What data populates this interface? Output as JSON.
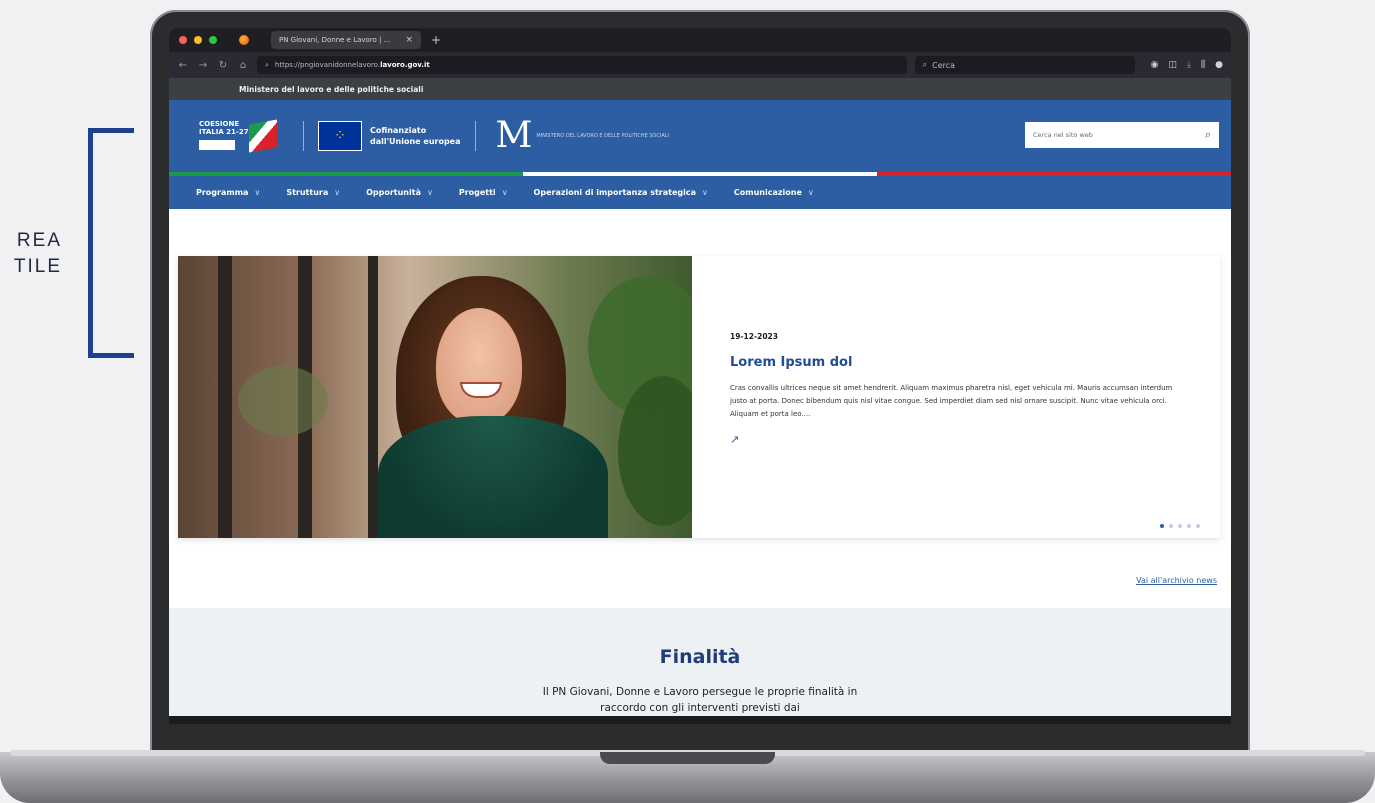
{
  "annotation": {
    "line1": "REA",
    "line2": "TILE"
  },
  "browser": {
    "tab_title": "PN Giovani, Donne e Lavoro | ...",
    "tab_close": "×",
    "new_tab": "+",
    "url_prefix": "https://pngiovanidonnelavoro.",
    "url_domain": "lavoro.gov.it",
    "search_placeholder": "Cerca"
  },
  "ministry": {
    "label": "Ministero del lavoro e delle politiche sociali"
  },
  "header": {
    "coesione_line1": "COESIONE",
    "coesione_line2": "ITALIA 21-27",
    "eu_line1": "Cofinanziato",
    "eu_line2": "dall'Unione europea",
    "m_letter": "M",
    "m_sub": "MINISTERO DEL LAVORO E DELLE POLITICHE SOCIALI",
    "site_search_placeholder": "Cerca nel sito web"
  },
  "nav": {
    "items": [
      {
        "label": "Programma"
      },
      {
        "label": "Struttura"
      },
      {
        "label": "Opportunità"
      },
      {
        "label": "Progetti"
      },
      {
        "label": "Operazioni di importanza strategica"
      },
      {
        "label": "Comunicazione"
      }
    ]
  },
  "hero": {
    "date": "19-12-2023",
    "title": "Lorem Ipsum dol",
    "body": "Cras convallis ultrices neque sit amet hendrerit. Aliquam maximus pharetra nisl, eget vehicula mi. Mauris accumsan interdum justo at porta. Donec bibendum quis nisl vitae congue. Sed imperdiet diam sed nisl ornare suscipit. Nunc vitae vehicula orci. Aliquam et porta leo....",
    "slides_total": 5,
    "slides_active": 1
  },
  "archive_link": "Vai all'archivio news",
  "finalita": {
    "title": "Finalità",
    "body": "Il PN Giovani, Donne e Lavoro persegue le proprie finalità in raccordo con gli interventi previsti dai"
  },
  "colors": {
    "brand_blue": "#2d5ea3",
    "tricolor_green": "#1a9b4b",
    "tricolor_white": "#ffffff",
    "tricolor_red": "#d8232a"
  }
}
